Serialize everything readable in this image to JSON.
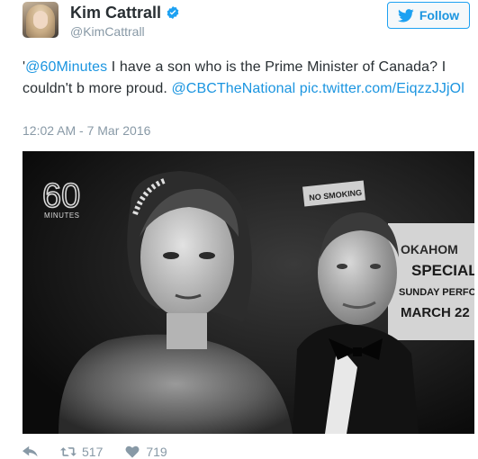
{
  "user": {
    "name": "Kim Cattrall",
    "handle": "@KimCattrall",
    "verified": true
  },
  "follow_button": {
    "label": "Follow",
    "icon": "twitter-bird-icon"
  },
  "tweet": {
    "segments": [
      {
        "text": "'",
        "type": "text"
      },
      {
        "text": "@60Minutes",
        "type": "link"
      },
      {
        "text": " I have a son who is the Prime Minister of Canada? I couldn't b more proud. ",
        "type": "text"
      },
      {
        "text": "@CBCTheNational",
        "type": "link"
      },
      {
        "text": " ",
        "type": "text"
      },
      {
        "text": "pic.twitter.com/EiqzzJJjOl",
        "type": "link"
      }
    ],
    "timestamp": "12:02 AM - 7 Mar 2016"
  },
  "media": {
    "logo_number": "60",
    "logo_text": "MINUTES",
    "sign_no_smoking": "NO SMOKING",
    "sign_lines": [
      "OKAHOM",
      "SPECIAL",
      "SUNDAY PERFORMA",
      "MARCH 22"
    ]
  },
  "actions": {
    "reply_icon": "reply-icon",
    "retweet_icon": "retweet-icon",
    "retweet_count": "517",
    "like_icon": "heart-icon",
    "like_count": "719"
  },
  "colors": {
    "link": "#1b95e0",
    "follow_border": "#1da1f2",
    "secondary_text": "#8899a6",
    "verified": "#1da1f2"
  }
}
